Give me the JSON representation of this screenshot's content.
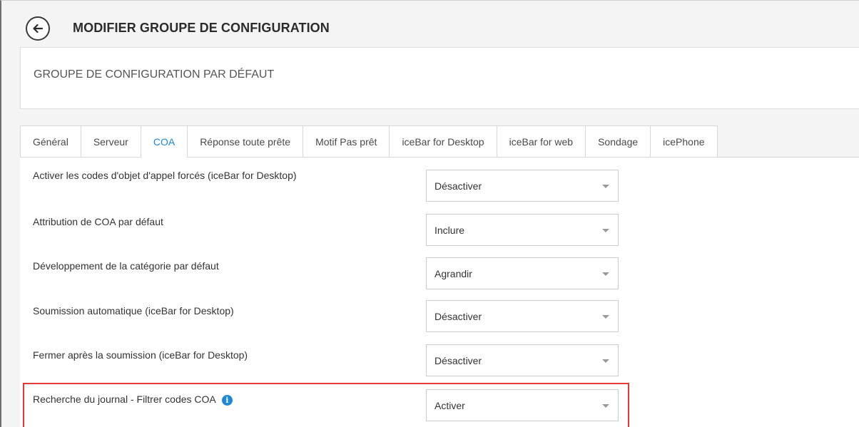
{
  "header": {
    "back_icon": "arrow-left-circle-icon",
    "title": "MODIFIER GROUPE DE CONFIGURATION"
  },
  "group": {
    "name": "GROUPE DE CONFIGURATION PAR DÉFAUT"
  },
  "tabs": [
    {
      "label": "Général",
      "active": false
    },
    {
      "label": "Serveur",
      "active": false
    },
    {
      "label": "COA",
      "active": true
    },
    {
      "label": "Réponse toute prête",
      "active": false
    },
    {
      "label": "Motif Pas prêt",
      "active": false
    },
    {
      "label": "iceBar for Desktop",
      "active": false
    },
    {
      "label": "iceBar for web",
      "active": false
    },
    {
      "label": "Sondage",
      "active": false
    },
    {
      "label": "icePhone",
      "active": false
    }
  ],
  "settings": [
    {
      "label": "Activer les codes d'objet d'appel forcés (iceBar for Desktop)",
      "value": "Désactiver"
    },
    {
      "label": "Attribution de COA par défaut",
      "value": "Inclure"
    },
    {
      "label": "Développement de la catégorie par défaut",
      "value": "Agrandir"
    },
    {
      "label": "Soumission automatique (iceBar for Desktop)",
      "value": "Désactiver"
    },
    {
      "label": "Fermer après la soumission (iceBar for Desktop)",
      "value": "Désactiver"
    },
    {
      "label": "Recherche du journal - Filtrer codes COA",
      "value": "Activer",
      "info": "i"
    }
  ],
  "colors": {
    "accent": "#1e88d8",
    "highlight": "#e53935",
    "background": "#f4f4f4"
  }
}
